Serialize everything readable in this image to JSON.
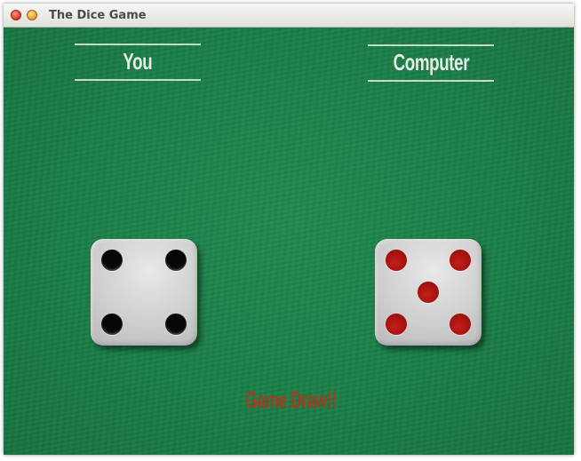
{
  "window": {
    "title": "The Dice Game"
  },
  "players": {
    "you": {
      "label": "You",
      "die_value": 4,
      "pip_color": "#060606"
    },
    "computer": {
      "label": "Computer",
      "die_value": 5,
      "pip_color": "#a51410"
    }
  },
  "result": {
    "text": "Game Draw!!",
    "color": "#a83a22"
  },
  "colors": {
    "felt": "#1e7a46",
    "die_face": "#d2d2d2"
  }
}
